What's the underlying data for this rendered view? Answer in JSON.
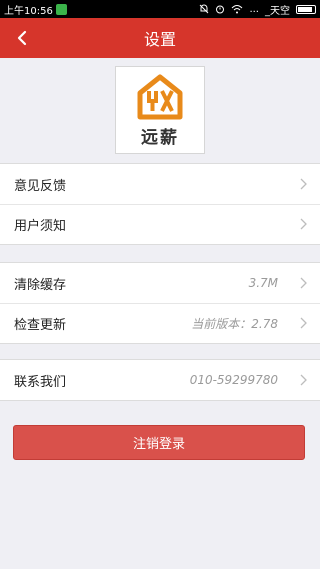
{
  "status_bar": {
    "time": "上午10:56",
    "network": "...",
    "carrier": "_天空"
  },
  "navbar": {
    "title": "设置",
    "back_icon": "chevron-left-icon"
  },
  "logo": {
    "brand_text": "远薪",
    "mark_text": "YX"
  },
  "group1": [
    {
      "label": "意见反馈"
    },
    {
      "label": "用户须知"
    }
  ],
  "group2": [
    {
      "label": "清除缓存",
      "value": "3.7M"
    },
    {
      "label": "检查更新",
      "value": "当前版本：2.78"
    }
  ],
  "group3": [
    {
      "label": "联系我们",
      "value": "010-59299780"
    }
  ],
  "logout_label": "注销登录",
  "colors": {
    "nav_bg": "#d6352b",
    "logout_bg": "#d9514b",
    "logo_orange": "#e88a1a"
  }
}
